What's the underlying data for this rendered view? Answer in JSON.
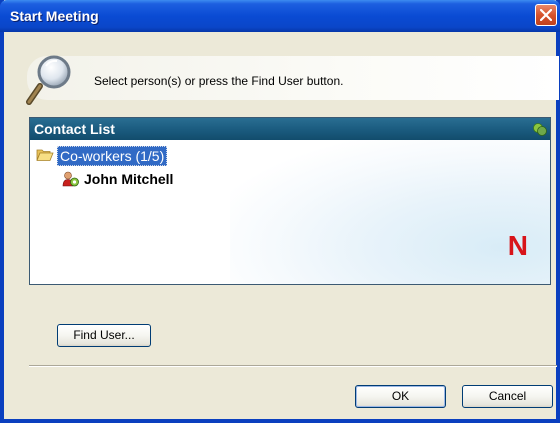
{
  "window": {
    "title": "Start Meeting"
  },
  "hint": {
    "icon": "magnifier-icon",
    "text": "Select person(s) or press the Find User button."
  },
  "contact_list": {
    "header": "Contact List",
    "groups": [
      {
        "label": "Co-workers  (1/5)",
        "selected": true,
        "members": [
          {
            "name": "John Mitchell",
            "status": "online"
          }
        ]
      }
    ],
    "logo": "N"
  },
  "buttons": {
    "find_user": "Find User...",
    "ok": "OK",
    "cancel": "Cancel"
  },
  "colors": {
    "title_bar": "#0a4bd4",
    "contact_header": "#1b5c80",
    "selection": "#316ac5",
    "logo": "#d8141a"
  }
}
